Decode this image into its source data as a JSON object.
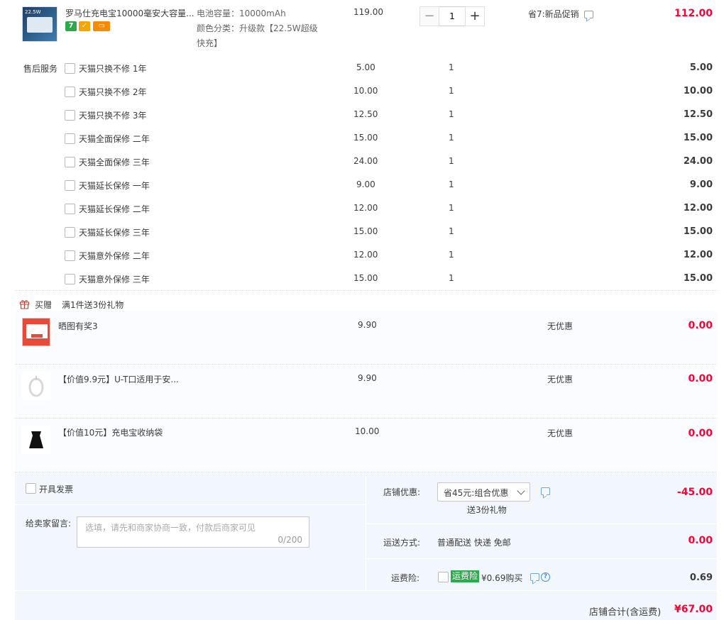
{
  "product": {
    "title": "罗马仕充电宝10000毫安大容量...",
    "spec_capacity": "电池容量：10000mAh",
    "spec_color_line1": "颜色分类：升级款【22.5W超级",
    "spec_color_line2": "快充】",
    "unit_price": "119.00",
    "quantity": "1",
    "promo": "省7:新品促销",
    "subtotal": "112.00",
    "badges": [
      "7",
      "shield",
      "card"
    ],
    "thumb_text": "22.5W"
  },
  "after_sales": {
    "label": "售后服务",
    "items": [
      {
        "name": "天猫只换不修 1年",
        "price": "5.00",
        "qty": "1",
        "total": "5.00"
      },
      {
        "name": "天猫只换不修 2年",
        "price": "10.00",
        "qty": "1",
        "total": "10.00"
      },
      {
        "name": "天猫只换不修 3年",
        "price": "12.50",
        "qty": "1",
        "total": "12.50"
      },
      {
        "name": "天猫全面保修 二年",
        "price": "15.00",
        "qty": "1",
        "total": "15.00"
      },
      {
        "name": "天猫全面保修 三年",
        "price": "24.00",
        "qty": "1",
        "total": "24.00"
      },
      {
        "name": "天猫延长保修 一年",
        "price": "9.00",
        "qty": "1",
        "total": "9.00"
      },
      {
        "name": "天猫延长保修 二年",
        "price": "12.00",
        "qty": "1",
        "total": "12.00"
      },
      {
        "name": "天猫延长保修 三年",
        "price": "15.00",
        "qty": "1",
        "total": "15.00"
      },
      {
        "name": "天猫意外保修 二年",
        "price": "12.00",
        "qty": "1",
        "total": "12.00"
      },
      {
        "name": "天猫意外保修 三年",
        "price": "15.00",
        "qty": "1",
        "total": "15.00"
      }
    ]
  },
  "gifts": {
    "header_label": "买赠",
    "header_desc": "满1件送3份礼物",
    "items": [
      {
        "name": "晒图有奖3",
        "price": "9.90",
        "discount": "无优惠",
        "total": "0.00"
      },
      {
        "name": "【价值9.9元】U-T口适用于安...",
        "price": "9.90",
        "discount": "无优惠",
        "total": "0.00"
      },
      {
        "name": "【价值10元】充电宝收纳袋",
        "price": "10.00",
        "discount": "无优惠",
        "total": "0.00"
      }
    ]
  },
  "order_options": {
    "invoice_label": "开具发票",
    "message_label": "给卖家留言:",
    "message_placeholder": "选填，请先和商家协商一致，付款后商家可见",
    "message_count": "0/200",
    "shop_discount_label": "店铺优惠:",
    "shop_discount_selected": "省45元:组合优惠",
    "shop_discount_sub": "送3份礼物",
    "shop_discount_amount": "-45.00",
    "shipping_label": "运送方式:",
    "shipping_value": "普通配送 快递 免邮",
    "shipping_amount": "0.00",
    "insurance_label": "运费险:",
    "insurance_tag": "运费险",
    "insurance_price": "¥0.69购买",
    "insurance_amount": "0.69"
  },
  "footer": {
    "total_label": "店铺合计(含运费)",
    "total_amount": "¥67.00"
  },
  "colors": {
    "price_red": "#ff0036",
    "panel_bg": "#f2f6fd",
    "insurance_green": "#2eaa4e",
    "link_blue": "#3d8ede"
  }
}
